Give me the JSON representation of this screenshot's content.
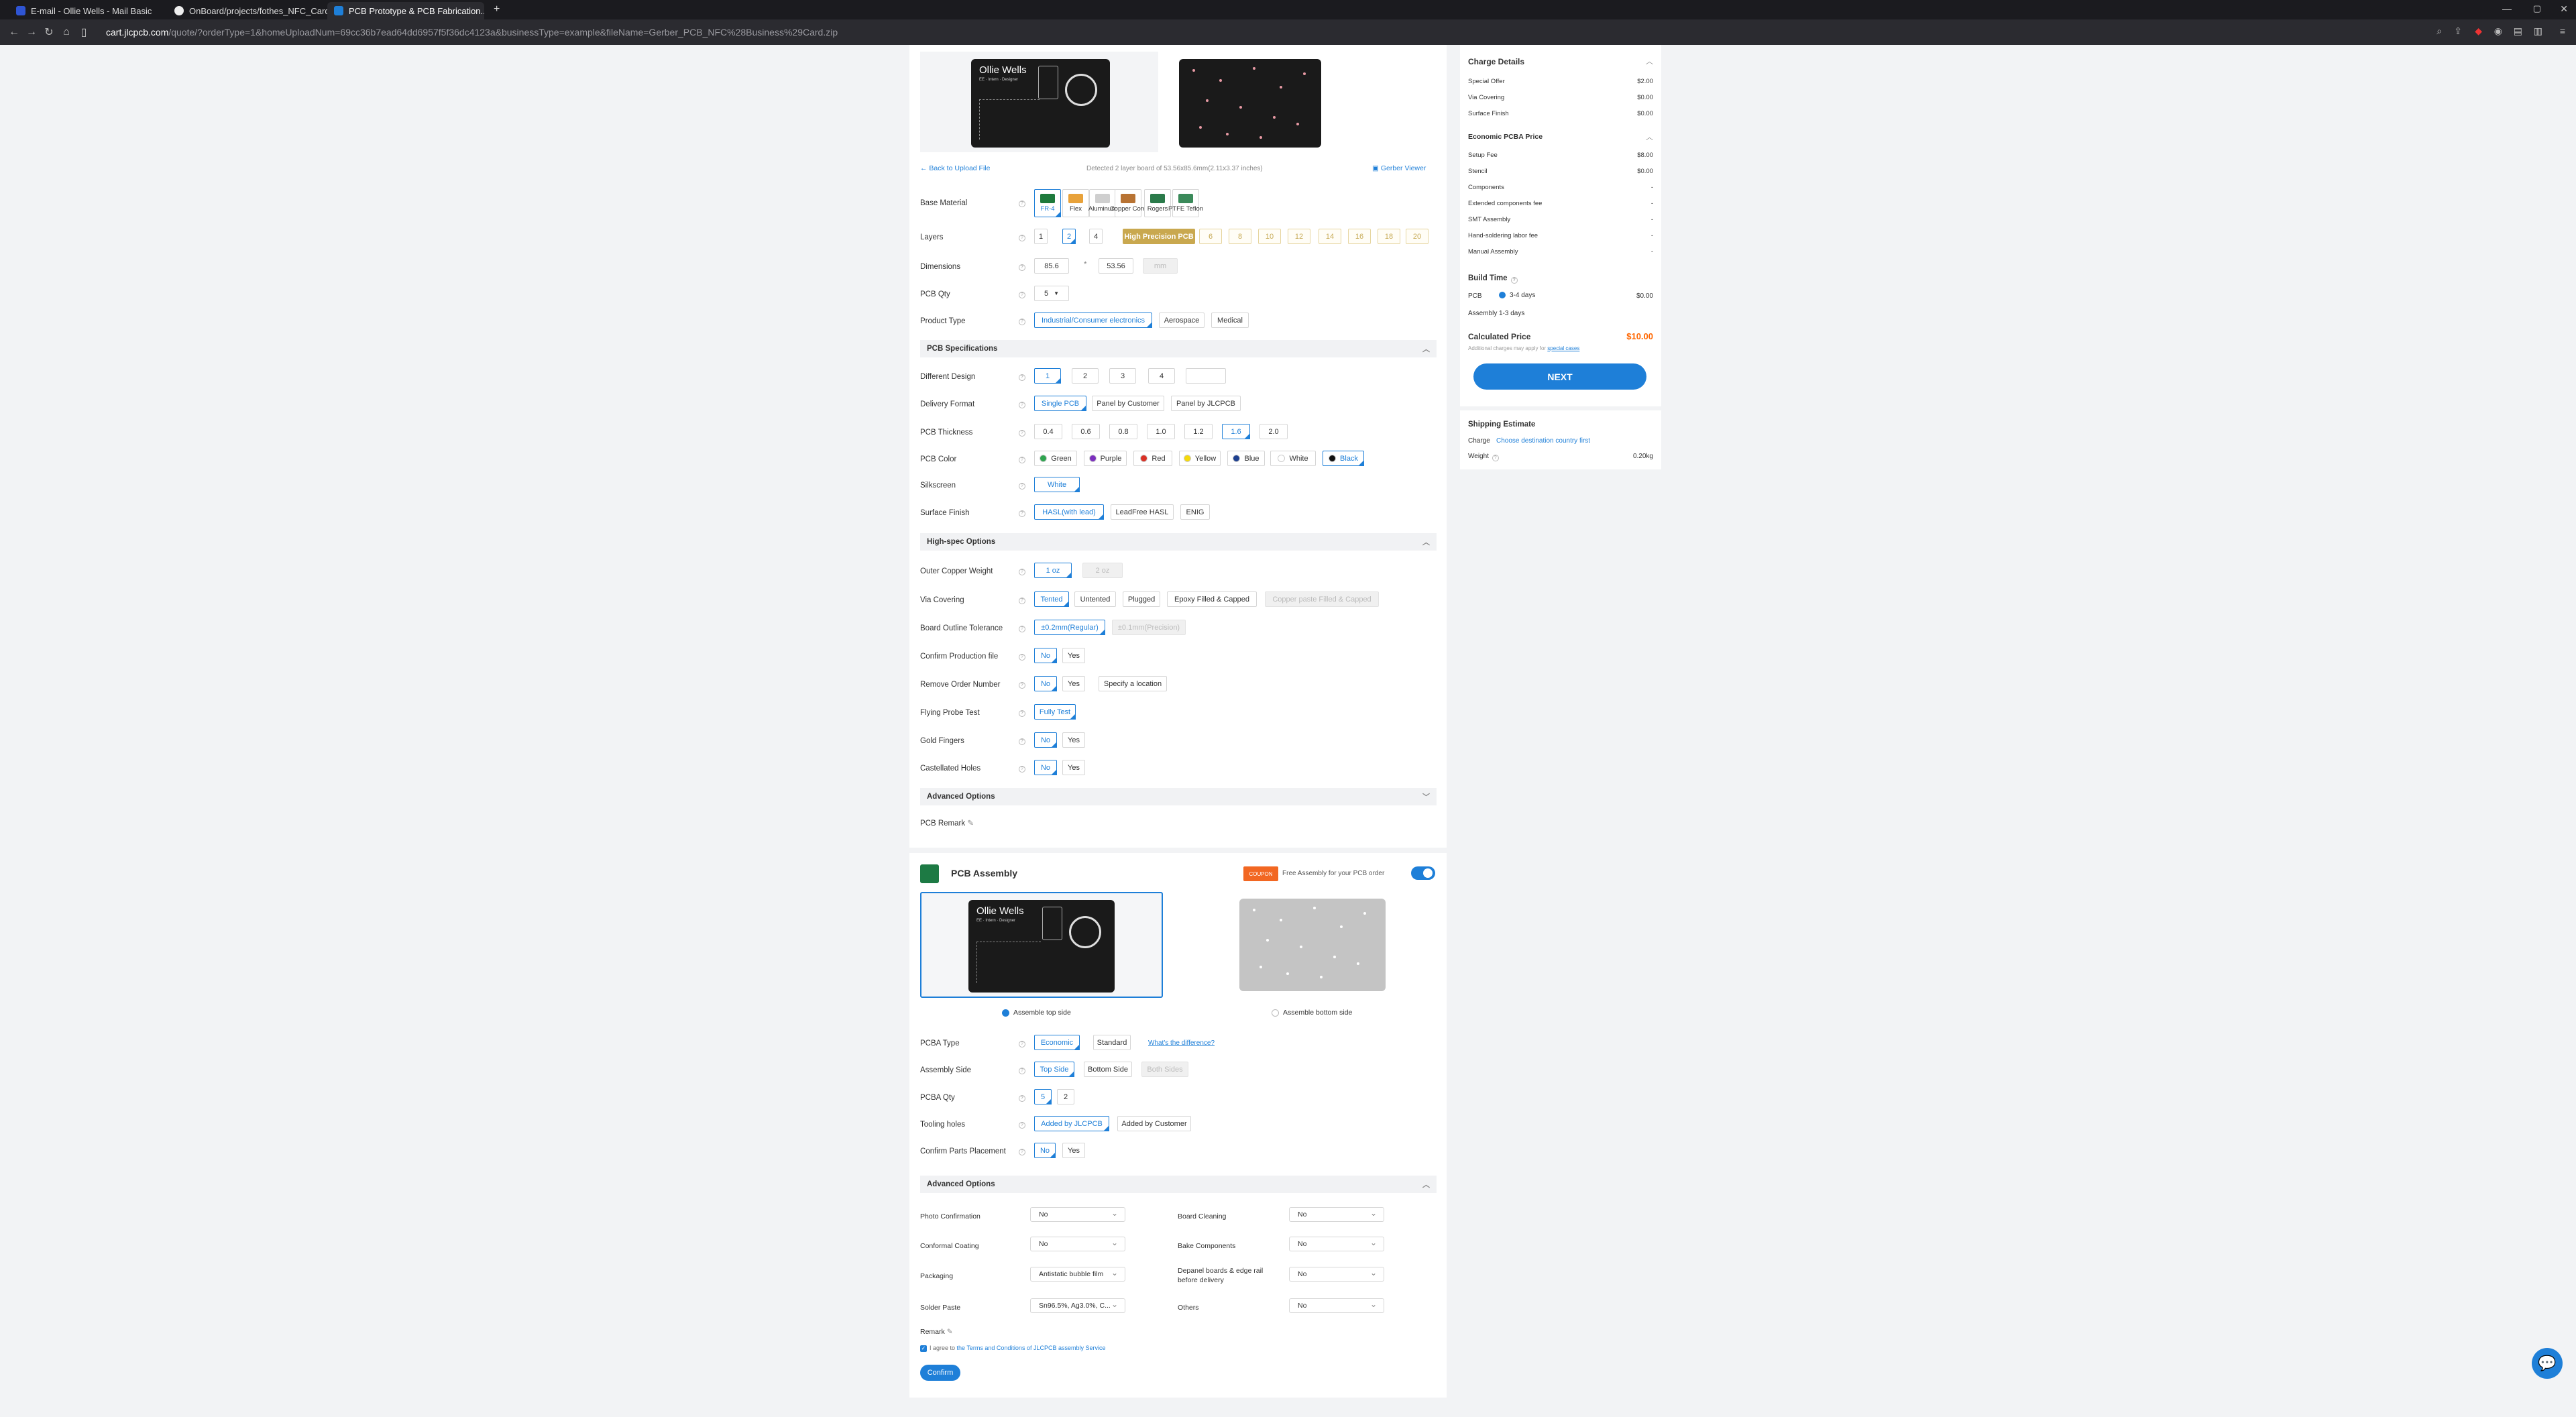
{
  "browser": {
    "tabs": [
      {
        "title": "E-mail - Ollie Wells - Mail Basic"
      },
      {
        "title": "OnBoard/projects/fothes_NFC_Card/..."
      },
      {
        "title": "PCB Prototype & PCB Fabrication..."
      }
    ],
    "url_host": "cart.jlcpcb.com",
    "url_path": "/quote/?orderType=1&homeUploadNum=69cc36b7ead64dd6957f5f36dc4123a&businessType=example&fileName=Gerber_PCB_NFC%28Business%29Card.zip"
  },
  "upload": {
    "back_link": "Back to Upload File",
    "detected_text": "Detected 2 layer board of 53.56x85.6mm(2.11x3.37 inches)",
    "gerber_viewer": "Gerber Viewer",
    "board_name": "Ollie Wells",
    "board_sub": "EE · Intern · Designer"
  },
  "pcb": {
    "base_material": {
      "label": "Base Material",
      "options": [
        "FR-4",
        "Flex",
        "Aluminum",
        "Copper Core",
        "Rogers",
        "PTFE Teflon"
      ]
    },
    "layers": {
      "label": "Layers",
      "options": [
        "1",
        "2",
        "4"
      ],
      "hp_label": "High Precision PCB",
      "hp_options": [
        "6",
        "8",
        "10",
        "12",
        "14",
        "16",
        "18",
        "20"
      ]
    },
    "dimensions": {
      "label": "Dimensions",
      "width": "85.6",
      "sep": "*",
      "height": "53.56",
      "unit": "mm"
    },
    "qty": {
      "label": "PCB Qty",
      "value": "5"
    },
    "product_type": {
      "label": "Product Type",
      "options": [
        "Industrial/Consumer electronics",
        "Aerospace",
        "Medical"
      ]
    },
    "spec_title": "PCB Specifications",
    "different_design": {
      "label": "Different Design",
      "options": [
        "1",
        "2",
        "3",
        "4"
      ]
    },
    "delivery_format": {
      "label": "Delivery Format",
      "options": [
        "Single PCB",
        "Panel by Customer",
        "Panel by JLCPCB"
      ]
    },
    "thickness": {
      "label": "PCB Thickness",
      "options": [
        "0.4",
        "0.6",
        "0.8",
        "1.0",
        "1.2",
        "1.6",
        "2.0"
      ]
    },
    "color": {
      "label": "PCB Color",
      "options": [
        "Green",
        "Purple",
        "Red",
        "Yellow",
        "Blue",
        "White",
        "Black"
      ],
      "colors": [
        "#2ea44f",
        "#7b2fbe",
        "#d93025",
        "#f5d90a",
        "#1d3f8f",
        "#ffffff",
        "#111111"
      ]
    },
    "silkscreen": {
      "label": "Silkscreen",
      "value": "White"
    },
    "surface_finish": {
      "label": "Surface Finish",
      "options": [
        "HASL(with lead)",
        "LeadFree HASL",
        "ENIG"
      ]
    },
    "highspec_title": "High-spec Options",
    "outer_copper": {
      "label": "Outer Copper Weight",
      "options": [
        "1 oz",
        "2 oz"
      ]
    },
    "via_covering": {
      "label": "Via Covering",
      "options": [
        "Tented",
        "Untented",
        "Plugged",
        "Epoxy Filled & Capped",
        "Copper paste Filled & Capped"
      ]
    },
    "outline_tol": {
      "label": "Board Outline Tolerance",
      "options": [
        "±0.2mm(Regular)",
        "±0.1mm(Precision)"
      ]
    },
    "confirm_prod": {
      "label": "Confirm Production file",
      "options": [
        "No",
        "Yes"
      ]
    },
    "remove_order": {
      "label": "Remove Order Number",
      "options": [
        "No",
        "Yes",
        "Specify a location"
      ]
    },
    "flying_probe": {
      "label": "Flying Probe Test",
      "value": "Fully Test"
    },
    "gold_fingers": {
      "label": "Gold Fingers",
      "options": [
        "No",
        "Yes"
      ]
    },
    "castellated": {
      "label": "Castellated Holes",
      "options": [
        "No",
        "Yes"
      ]
    },
    "advanced_title": "Advanced Options",
    "remark": "PCB Remark"
  },
  "assembly": {
    "title": "PCB Assembly",
    "coupon_badge": "COUPON",
    "free_text": "Free Assembly for your PCB order",
    "top_side": "Assemble top side",
    "bottom_side": "Assemble bottom side",
    "pcba_type": {
      "label": "PCBA Type",
      "options": [
        "Economic",
        "Standard"
      ],
      "link": "What's the difference?"
    },
    "assembly_side": {
      "label": "Assembly Side",
      "options": [
        "Top Side",
        "Bottom Side",
        "Both Sides"
      ]
    },
    "pcba_qty": {
      "label": "PCBA Qty",
      "options": [
        "5",
        "2"
      ]
    },
    "tooling": {
      "label": "Tooling holes",
      "options": [
        "Added by JLCPCB",
        "Added by Customer"
      ]
    },
    "confirm_parts": {
      "label": "Confirm Parts Placement",
      "options": [
        "No",
        "Yes"
      ]
    },
    "advanced_title": "Advanced Options",
    "adv": {
      "photo": {
        "label": "Photo Confirmation",
        "value": "No"
      },
      "board_cleaning": {
        "label": "Board Cleaning",
        "value": "No"
      },
      "conformal": {
        "label": "Conformal Coating",
        "value": "No"
      },
      "bake": {
        "label": "Bake Components",
        "value": "No"
      },
      "packaging": {
        "label": "Packaging",
        "value": "Antistatic bubble film"
      },
      "depanel": {
        "label": "Depanel boards & edge rail before delivery",
        "value": "No"
      },
      "solder": {
        "label": "Solder Paste",
        "value": "Sn96.5%, Ag3.0%, C..."
      },
      "others": {
        "label": "Others",
        "value": "No"
      }
    },
    "remark": "Remark",
    "agree_prefix": "I agree to",
    "agree_link": "the Terms and Conditions of JLCPCB assembly Service",
    "confirm_btn": "Confirm"
  },
  "charges": {
    "title": "Charge Details",
    "rows": [
      {
        "label": "Special Offer",
        "value": "$2.00"
      },
      {
        "label": "Via Covering",
        "value": "$0.00"
      },
      {
        "label": "Surface Finish",
        "value": "$0.00"
      }
    ],
    "pcba_title": "Economic PCBA Price",
    "pcba_rows": [
      {
        "label": "Setup Fee",
        "value": "$8.00"
      },
      {
        "label": "Stencil",
        "value": "$0.00"
      },
      {
        "label": "Components",
        "value": "-"
      },
      {
        "label": "Extended components fee",
        "value": "-"
      },
      {
        "label": "SMT Assembly",
        "value": "-"
      },
      {
        "label": "Hand-soldering labor fee",
        "value": "-"
      },
      {
        "label": "Manual Assembly",
        "value": "-"
      }
    ],
    "build_title": "Build Time",
    "pcb_label": "PCB",
    "pcb_time": "3-4 days",
    "pcb_time_price": "$0.00",
    "assembly_label": "Assembly",
    "assembly_time": "1-3 days",
    "calc_title": "Calculated Price",
    "calc_value": "$10.00",
    "calc_note": "Additional charges may apply for",
    "calc_note_link": "special cases",
    "next_btn": "NEXT",
    "ship_title": "Shipping Estimate",
    "ship_charge_label": "Charge",
    "ship_charge_link": "Choose destination country first",
    "ship_weight_label": "Weight",
    "ship_weight": "0.20kg"
  },
  "colors": {
    "accent": "#1e7fd8",
    "price": "#ff6600",
    "next": "#1e7fd8",
    "gold": "#c7ab57"
  }
}
